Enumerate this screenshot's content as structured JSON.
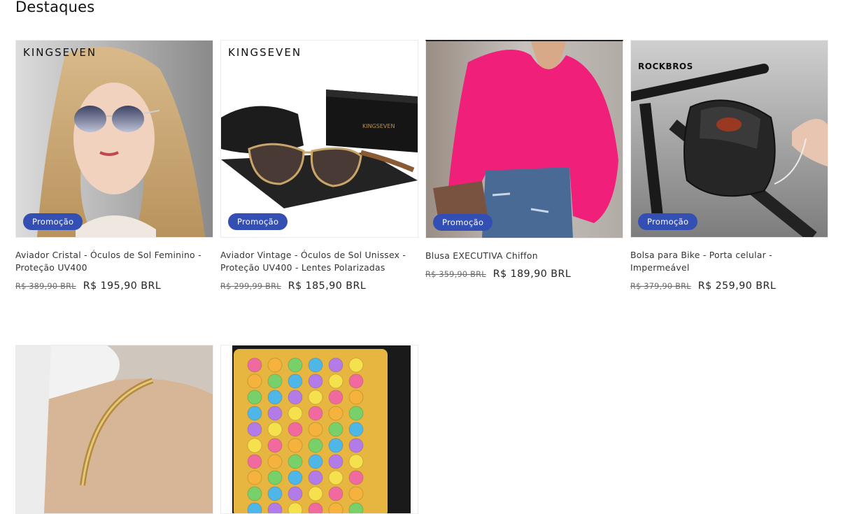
{
  "section": {
    "title": "Destaques"
  },
  "products": [
    {
      "brand": "KINGSEVEN",
      "badge": "Promoção",
      "title": "Aviador Cristal - Óculos de Sol Feminino - Proteção UV400",
      "old_price": "R$ 389,90 BRL",
      "price": "R$ 195,90 BRL"
    },
    {
      "brand": "KINGSEVEN",
      "badge": "Promoção",
      "title": "Aviador Vintage - Óculos de Sol Unissex - Proteção UV400 - Lentes Polarizadas",
      "old_price": "R$ 299,99 BRL",
      "price": "R$ 185,90 BRL"
    },
    {
      "badge": "Promoção",
      "title": "Blusa EXECUTIVA Chiffon",
      "old_price": "R$ 359,90 BRL",
      "price": "R$ 189,90 BRL"
    },
    {
      "brand": "ROCKBROS",
      "badge": "Promoção",
      "title": "Bolsa para Bike - Porta celular - Impermeável",
      "old_price": "R$ 379,90 BRL",
      "price": "R$ 259,90 BRL"
    },
    {
      "image": "gold-bracelet"
    },
    {
      "image": "pop-it-notebook"
    }
  ]
}
